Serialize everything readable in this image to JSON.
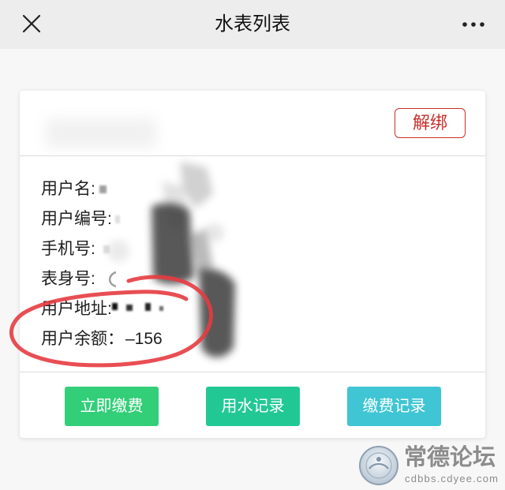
{
  "header": {
    "title": "水表列表",
    "close_icon": "close-icon",
    "more_icon": "more-icon"
  },
  "card": {
    "unbind_label": "解绑",
    "fields": [
      {
        "label": "用户名:"
      },
      {
        "label": "用户编号:"
      },
      {
        "label": "手机号:"
      },
      {
        "label": "表身号:"
      },
      {
        "label": "用户地址:"
      },
      {
        "label": "用户余额：",
        "value": "–156"
      }
    ],
    "actions": [
      {
        "label": "立即缴费",
        "color": "#33ce78"
      },
      {
        "label": "用水记录",
        "color": "#22c894"
      },
      {
        "label": "缴费记录",
        "color": "#3fc5d4"
      }
    ]
  },
  "watermark": {
    "logo_icon": "seal-logo-icon",
    "name": "常德论坛",
    "site": "cdbbs.cdyee.com"
  },
  "colors": {
    "header_bg": "#ededed",
    "unbind": "#c9302c",
    "annotation": "#e63b40",
    "redaction": "#3a3a3a"
  }
}
